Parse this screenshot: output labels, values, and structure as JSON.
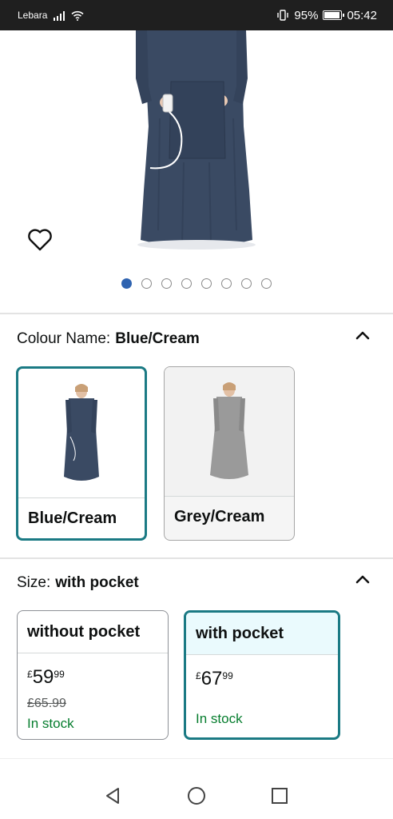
{
  "status_bar": {
    "carrier": "Lebara",
    "battery_percent": "95%",
    "battery_level": 0.95,
    "time": "05:42",
    "icons": [
      "signal-icon",
      "wifi-icon",
      "vibrate-icon",
      "battery-icon"
    ]
  },
  "gallery": {
    "image_count": 8,
    "active_index": 0
  },
  "colour": {
    "label": "Colour Name:",
    "value": "Blue/Cream",
    "options": [
      {
        "name": "Blue/Cream",
        "selected": true,
        "color": "#3a4a63"
      },
      {
        "name": "Grey/Cream",
        "selected": false,
        "color": "#8e8e8e"
      }
    ]
  },
  "size": {
    "label": "Size:",
    "value": "with pocket",
    "options": [
      {
        "name": "without pocket",
        "price_currency": "£",
        "price_whole": "59",
        "price_fraction": "99",
        "was_price": "£65.99",
        "stock": "In stock",
        "selected": false
      },
      {
        "name": "with pocket",
        "price_currency": "£",
        "price_whole": "67",
        "price_fraction": "99",
        "was_price": "",
        "stock": "In stock",
        "selected": true
      }
    ]
  },
  "colors": {
    "accent": "#1b7a84",
    "dot_active": "#2f63b0",
    "in_stock": "#067d2e"
  }
}
